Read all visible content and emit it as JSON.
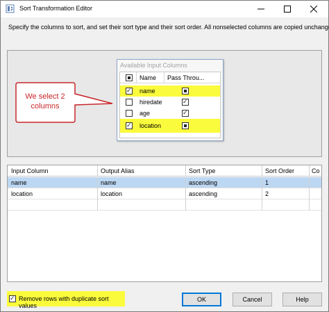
{
  "window": {
    "title": "Sort Transformation Editor"
  },
  "description": "Specify the columns to sort, and set their sort type and their sort order. All nonselected columns are copied unchanged.",
  "available_columns": {
    "title": "Available Input Columns",
    "headers": {
      "name": "Name",
      "pass_through": "Pass Throu..."
    },
    "rows": [
      {
        "name": "name",
        "checked": true,
        "pass_through": "filled",
        "highlighted": true
      },
      {
        "name": "hiredate",
        "checked": false,
        "pass_through": "checked",
        "highlighted": false
      },
      {
        "name": "age",
        "checked": false,
        "pass_through": "checked",
        "highlighted": false
      },
      {
        "name": "location",
        "checked": true,
        "pass_through": "filled",
        "highlighted": true
      }
    ]
  },
  "callout": {
    "line1": "We select 2",
    "line2": "columns",
    "border_color": "#c8262a"
  },
  "sort_grid": {
    "headers": [
      "Input Column",
      "Output Alias",
      "Sort Type",
      "Sort Order",
      "Co"
    ],
    "rows": [
      [
        "name",
        "name",
        "ascending",
        "1"
      ],
      [
        "location",
        "location",
        "ascending",
        "2"
      ]
    ]
  },
  "options": {
    "remove_duplicates_label": "Remove rows with duplicate sort values",
    "remove_duplicates_checked": true
  },
  "buttons": {
    "ok": "OK",
    "cancel": "Cancel",
    "help": "Help"
  },
  "colors": {
    "highlight": "#fbfb3d",
    "selection": "#bcd7f2",
    "accent": "#0078d7"
  }
}
